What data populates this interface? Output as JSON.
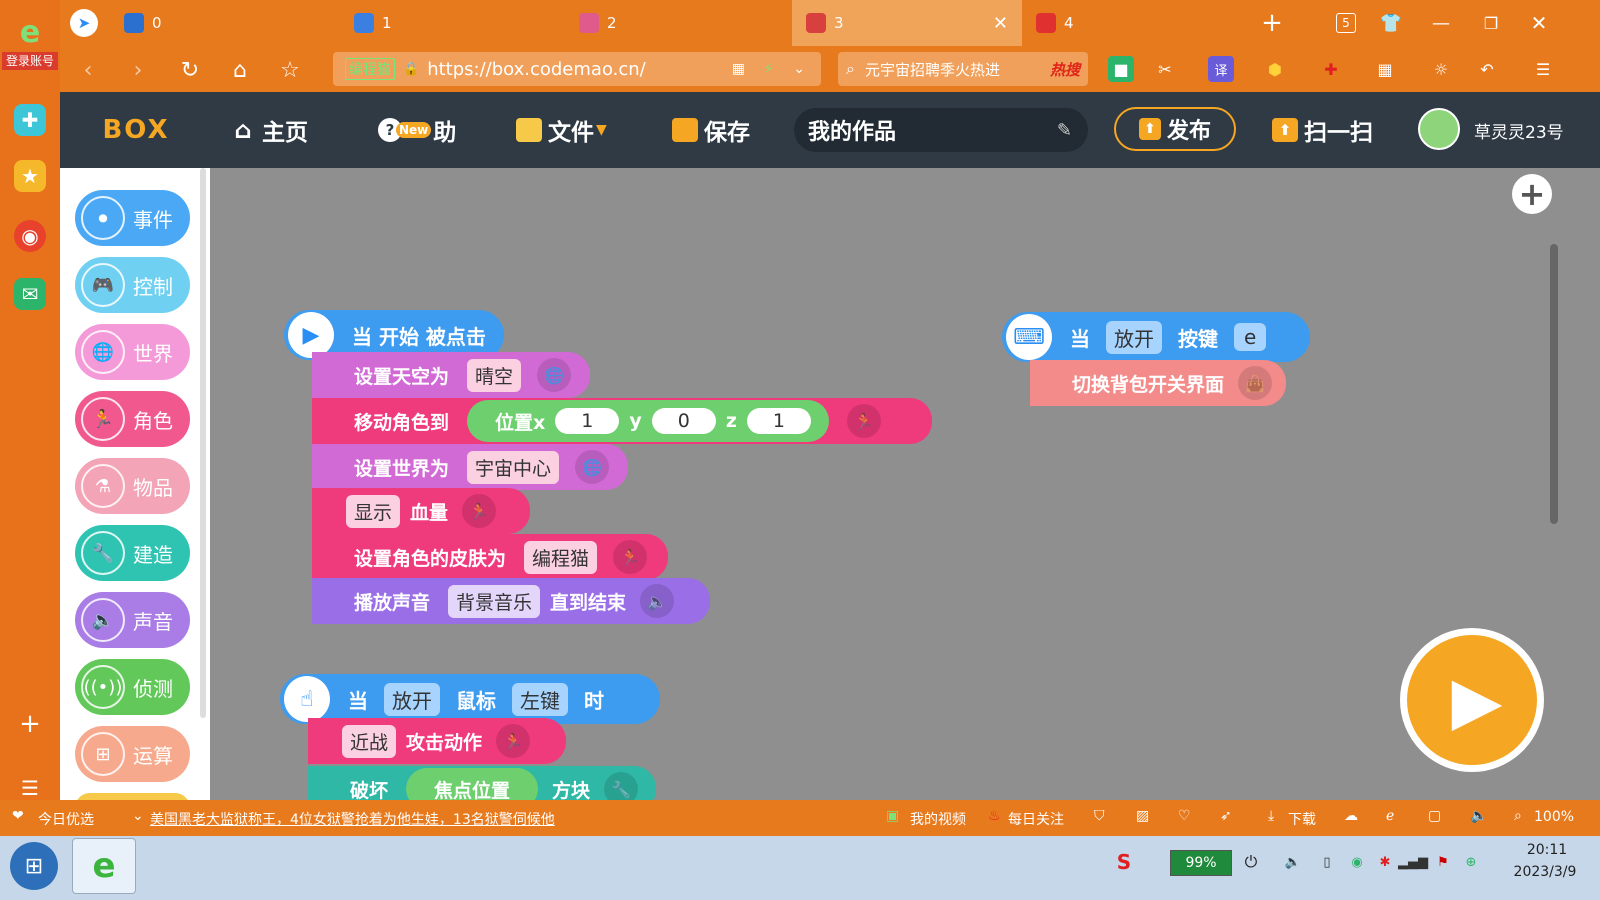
{
  "leftbar": {
    "login_label": "登录账号"
  },
  "tabs": [
    {
      "label": "0",
      "color": "#2b6fcf"
    },
    {
      "label": "1",
      "color": "#3b7fe0"
    },
    {
      "label": "2",
      "color": "#e05a8c"
    },
    {
      "label": "3",
      "color": "#d84040"
    },
    {
      "label": "4",
      "color": "#e03030"
    }
  ],
  "browser": {
    "new_tab_icon": "+",
    "tab_count": "5",
    "site_label": "编程猫",
    "url": "https://box.codemao.cn/",
    "search_text": "元宇宙招聘季火热进",
    "hot_label": "热搜"
  },
  "app": {
    "logo": "BOX",
    "home": "主页",
    "help": "助",
    "help_badge": "New",
    "file": "文件",
    "save": "保存",
    "project_title": "我的作品",
    "publish": "发布",
    "scan": "扫一扫",
    "username": "草灵灵23号"
  },
  "categories": [
    {
      "label": "事件",
      "color": "#4aa8f5"
    },
    {
      "label": "控制",
      "color": "#6fd0f2"
    },
    {
      "label": "世界",
      "color": "#f49ad8"
    },
    {
      "label": "角色",
      "color": "#f0588e"
    },
    {
      "label": "物品",
      "color": "#f3a4b6"
    },
    {
      "label": "建造",
      "color": "#2fc4b1"
    },
    {
      "label": "声音",
      "color": "#a97ce6"
    },
    {
      "label": "侦测",
      "color": "#62c85a"
    },
    {
      "label": "运算",
      "color": "#f7a98e"
    }
  ],
  "script1": {
    "hat": "当 开始 被点击",
    "sky_label": "设置天空为",
    "sky_value": "晴空",
    "move_label": "移动角色到",
    "pos_label": "位置x",
    "x": "1",
    "y_label": "y",
    "y": "0",
    "z_label": "z",
    "z": "1",
    "world_label": "设置世界为",
    "world_value": "宇宙中心",
    "show_value": "显示",
    "hp_label": "血量",
    "skin_label": "设置角色的皮肤为",
    "skin_value": "编程猫",
    "sound_label": "播放声音",
    "sound_value": "背景音乐",
    "until_label": "直到结束"
  },
  "script2": {
    "when": "当",
    "release": "放开",
    "mouse": "鼠标",
    "button": "左键",
    "time": "时",
    "melee": "近战",
    "attack": "攻击动作",
    "break": "破坏",
    "focus": "焦点位置",
    "block": "方块"
  },
  "script3": {
    "when": "当",
    "release": "放开",
    "key": "按键",
    "key_value": "e",
    "toggle": "切换背包开关界面"
  },
  "statusbar": {
    "today": "今日优选",
    "news": "美国黑老大监狱称王，4位女狱警抢着为他生娃，13名狱警伺候他",
    "video": "我的视频",
    "daily": "每日关注",
    "download": "下载",
    "zoom": "100%"
  },
  "taskbar": {
    "battery": "99%",
    "time": "20:11",
    "date": "2023/3/9"
  }
}
